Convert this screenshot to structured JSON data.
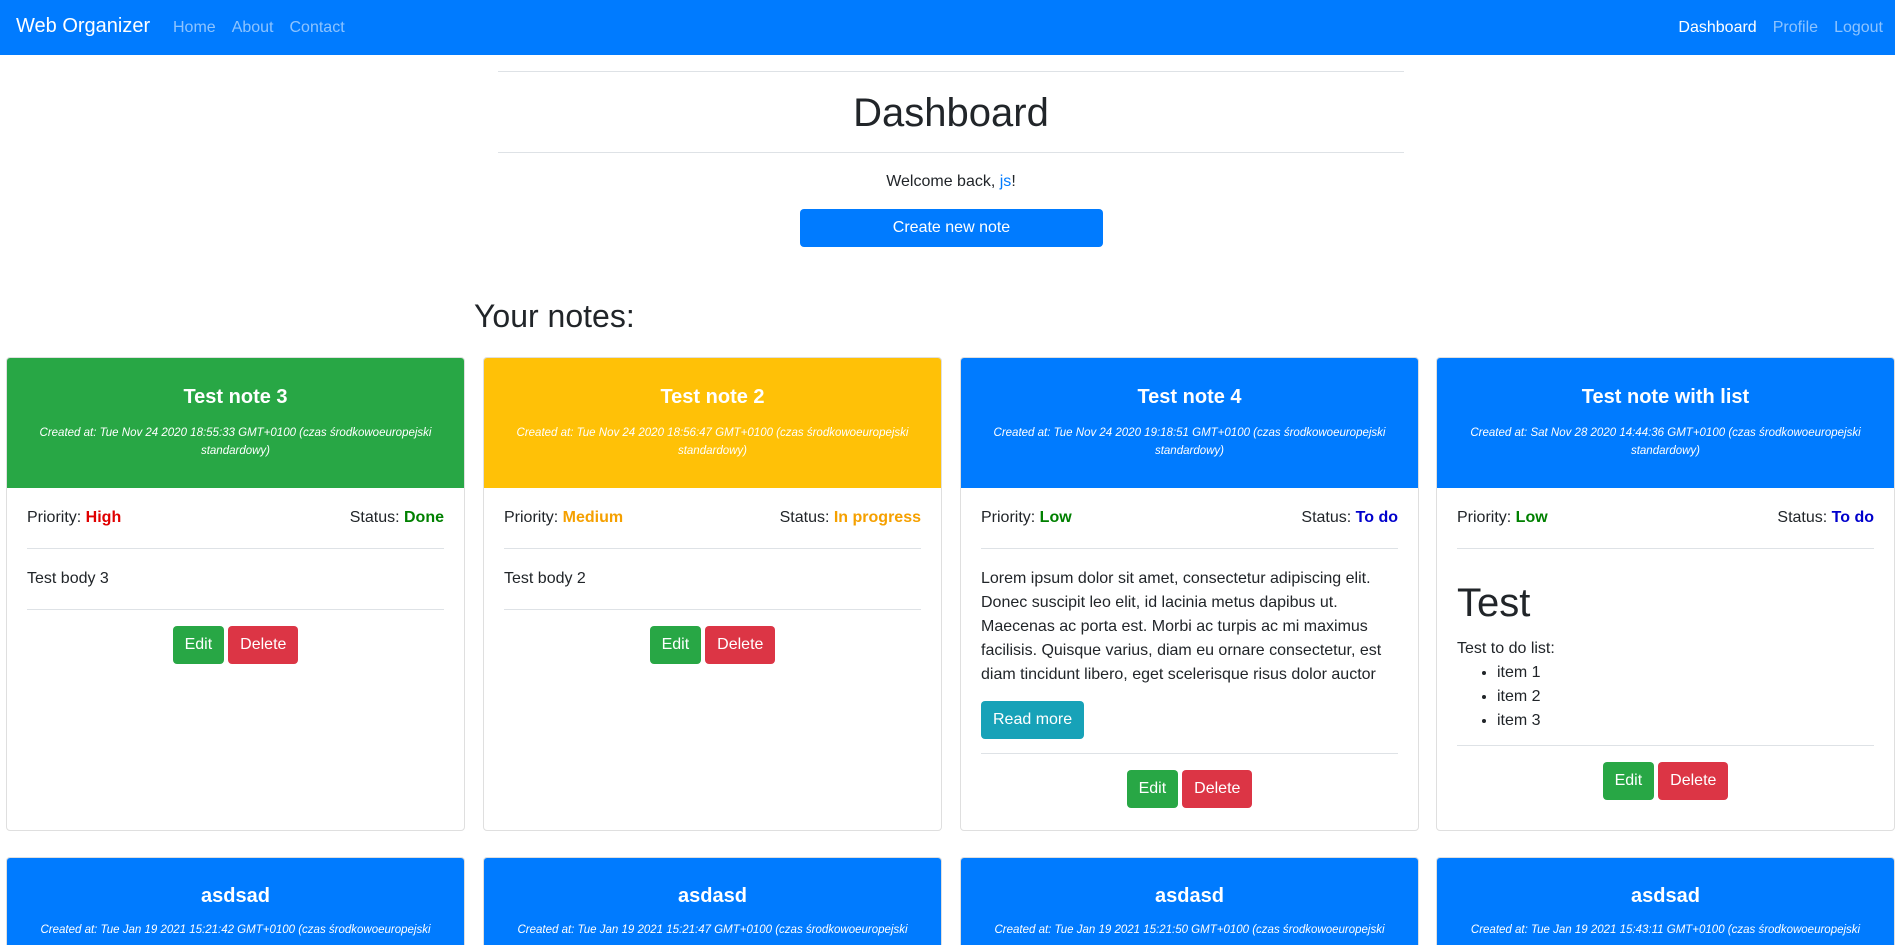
{
  "navbar": {
    "brand": "Web Organizer",
    "left_links": [
      "Home",
      "About",
      "Contact"
    ],
    "right_links": [
      "Dashboard",
      "Profile",
      "Logout"
    ]
  },
  "header": {
    "title": "Dashboard",
    "welcome_prefix": "Welcome back, ",
    "username": "js",
    "welcome_suffix": "!",
    "create_button": "Create new note",
    "notes_heading": "Your notes:"
  },
  "labels": {
    "priority": "Priority: ",
    "status": "Status: ",
    "edit": "Edit",
    "delete": "Delete",
    "read_more": "Read more"
  },
  "colors": {
    "green": "#28a745",
    "yellow": "#ffc107",
    "blue": "#007bff",
    "high": "#e00000",
    "medium": "#f5a000",
    "low": "#008000",
    "todo": "#0000cc"
  },
  "notes": [
    {
      "title": "Test note 3",
      "created": "Created at: Tue Nov 24 2020 18:55:33 GMT+0100 (czas środkowoeuropejski standardowy)",
      "priority": "High",
      "status": "Done",
      "body": "Test body 3"
    },
    {
      "title": "Test note 2",
      "created": "Created at: Tue Nov 24 2020 18:56:47 GMT+0100 (czas środkowoeuropejski standardowy)",
      "priority": "Medium",
      "status": "In progress",
      "body": "Test body 2"
    },
    {
      "title": "Test note 4",
      "created": "Created at: Tue Nov 24 2020 19:18:51 GMT+0100 (czas środkowoeuropejski standardowy)",
      "priority": "Low",
      "status": "To do",
      "body": "Lorem ipsum dolor sit amet, consectetur adipiscing elit. Donec suscipit leo elit, id lacinia metus dapibus ut. Maecenas ac porta est. Morbi ac turpis ac mi maximus facilisis. Quisque varius, diam eu ornare consectetur, est diam tincidunt libero, eget scelerisque risus dolor auctor"
    },
    {
      "title": "Test note with list",
      "created": "Created at: Sat Nov 28 2020 14:44:36 GMT+0100 (czas środkowoeuropejski standardowy)",
      "priority": "Low",
      "status": "To do",
      "body_heading": "Test",
      "body_intro": "Test to do list:",
      "body_items": [
        "item 1",
        "item 2",
        "item 3"
      ]
    },
    {
      "title": "asdsad",
      "created": "Created at: Tue Jan 19 2021 15:21:42 GMT+0100 (czas środkowoeuropejski"
    },
    {
      "title": "asdasd",
      "created": "Created at: Tue Jan 19 2021 15:21:47 GMT+0100 (czas środkowoeuropejski"
    },
    {
      "title": "asdasd",
      "created": "Created at: Tue Jan 19 2021 15:21:50 GMT+0100 (czas środkowoeuropejski"
    },
    {
      "title": "asdsad",
      "created": "Created at: Tue Jan 19 2021 15:43:11 GMT+0100 (czas środkowoeuropejski"
    }
  ]
}
